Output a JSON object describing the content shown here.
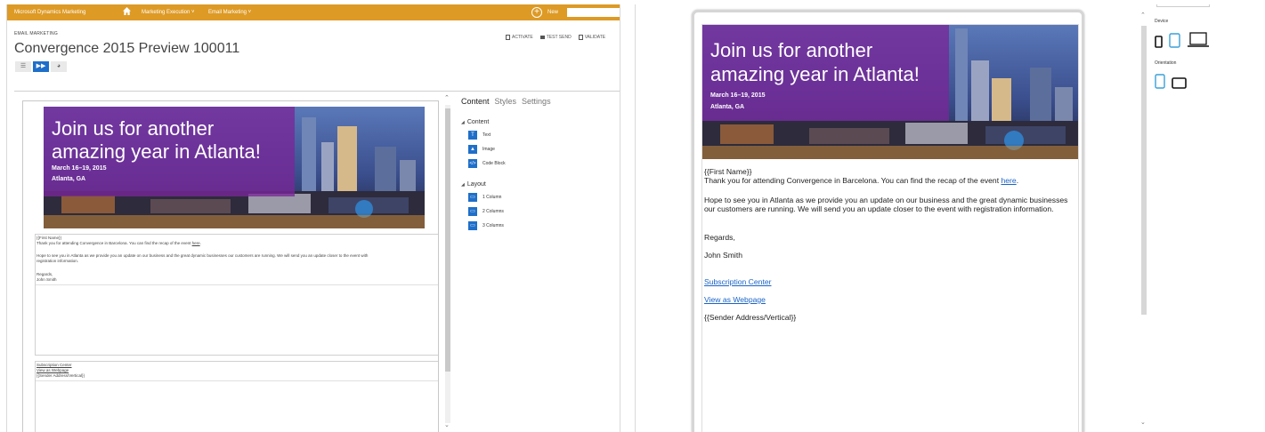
{
  "left": {
    "app_name": "Microsoft Dynamics Marketing",
    "nav": [
      "Marketing Execution ˅",
      "Email Marketing ˅"
    ],
    "new_label": "New",
    "category": "EMAIL MARKETING",
    "title": "Convergence 2015 Preview 100011",
    "actions": [
      "ACTIVATE",
      "TEST SEND",
      "VALIDATE"
    ],
    "side_tabs": [
      "Content",
      "Styles",
      "Settings"
    ],
    "content_section": "Content",
    "content_items": [
      "Text",
      "Image",
      "Code Block"
    ],
    "layout_section": "Layout",
    "layout_items": [
      "1 Column",
      "2 Columns",
      "3 Columns"
    ]
  },
  "email": {
    "hero_title": "Join us for another amazing year in Atlanta!",
    "hero_dates": "March 16–19, 2015",
    "hero_location": "Atlanta, GA",
    "greeting": "{{First Name}}",
    "line1_before": "Thank you for attending Convergence in Barcelona. You can find the recap of the event ",
    "line1_link": "here",
    "line1_after": ".",
    "para2a": "Hope to see you in Atlanta as we provide you an update on our business and the great dynamic businesses our customers are running. We will send you an update closer to the event with",
    "para2b": "registration information.",
    "para2_r1": "Hope to see you in Atlanta as we provide you an update on our business and the great dynamic businesses",
    "para2_r2": "our customers are running. We will send you an update closer to the event with registration information.",
    "regards": "Regards,",
    "signature": "John Smith",
    "subscription": "Subscription Center",
    "webpage": "View as Webpage",
    "sender": "{{Sender Address/Vertical}}"
  },
  "right": {
    "device_label": "Device",
    "orientation_label": "Orientation"
  },
  "colors": {
    "topbar": "#dd9a25",
    "accent": "#1e6fc9",
    "hero_overlay": "#782698",
    "link": "#1a63c6"
  }
}
